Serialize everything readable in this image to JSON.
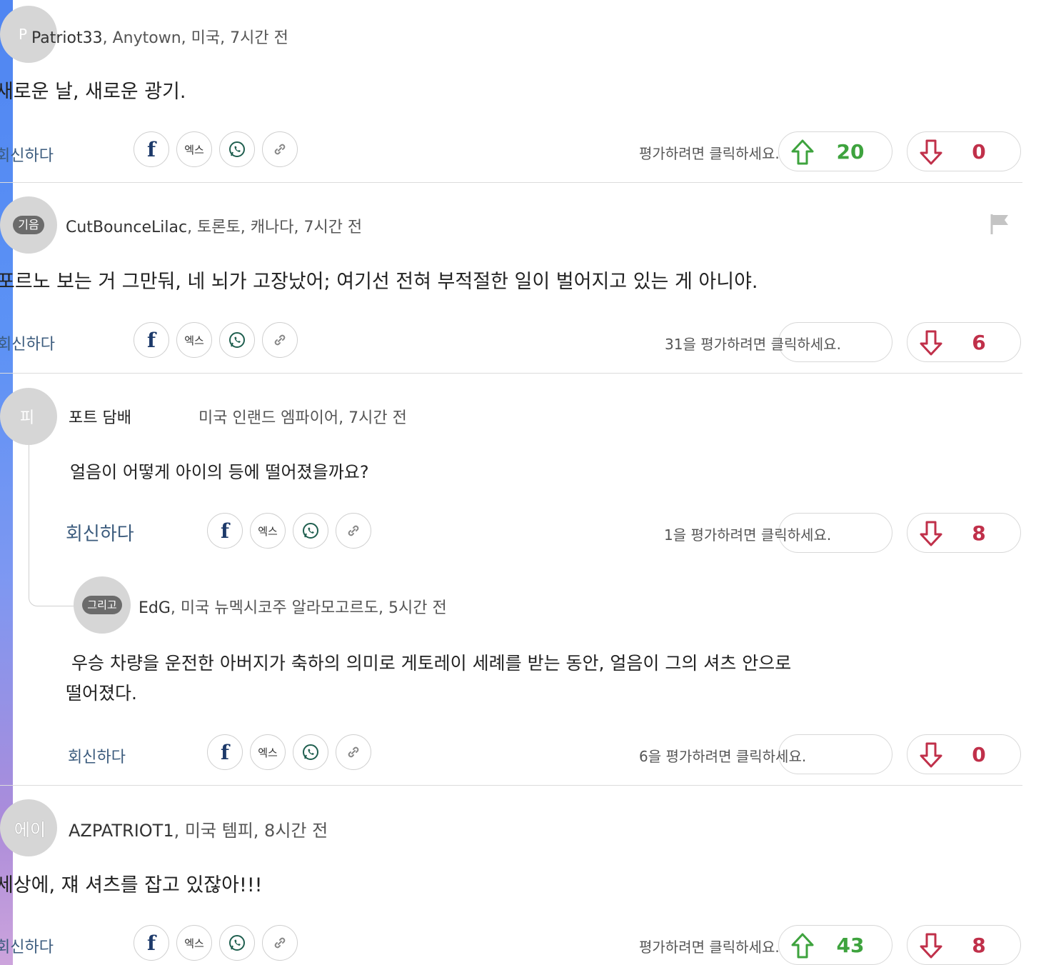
{
  "share": {
    "facebook_label": "f",
    "x_label": "엑스"
  },
  "comments": [
    {
      "avatar": "P",
      "author": "Patriot33",
      "location_time": ", Anytown, 미국, 7시간 전",
      "text": "새로운 날, 새로운 광기.",
      "reply_label": "회신하다",
      "rate_label": "평가하려면 클릭하세요.",
      "upvotes": "20",
      "downvotes": "0"
    },
    {
      "avatar": "기음",
      "author": "CutBounceLilac",
      "location_time": ", 토론토, 캐나다, 7시간 전",
      "text": "포르노 보는 거 그만둬, 네 뇌가 고장났어; 여기선 전혀 부적절한 일이 벌어지고 있는 게 아니야.",
      "reply_label": "회신하다",
      "rate_label": "31을 평가하려면 클릭하세요.",
      "downvotes": "6"
    },
    {
      "avatar": "피",
      "author": "포트 담배",
      "location_time": "미국 인랜드 엠파이어, 7시간 전",
      "text": "얼음이 어떻게 아이의 등에 떨어졌을까요?",
      "reply_label": "회신하다",
      "rate_label": "1을 평가하려면 클릭하세요.",
      "downvotes": "8"
    },
    {
      "avatar": "그리고",
      "author": "EdG",
      "location_time": ", 미국 뉴멕시코주 알라모고르도, 5시간 전",
      "text_line1": "우승 차량을 운전한 아버지가 축하의 의미로 게토레이 세례를 받는 동안, 얼음이 그의 셔츠 안으로",
      "text_line2": "떨어졌다.",
      "reply_label": "회신하다",
      "rate_label": "6을 평가하려면 클릭하세요.",
      "downvotes": "0"
    },
    {
      "avatar": "에이",
      "author": "AZPATRIOT1",
      "location_time": ", 미국 템피, 8시간 전",
      "text": "세상에, 쟤 셔츠를 잡고 있잖아!!!",
      "reply_label": "회신하다",
      "rate_label": "평가하려면 클릭하세요.",
      "upvotes": "43",
      "downvotes": "8"
    }
  ]
}
